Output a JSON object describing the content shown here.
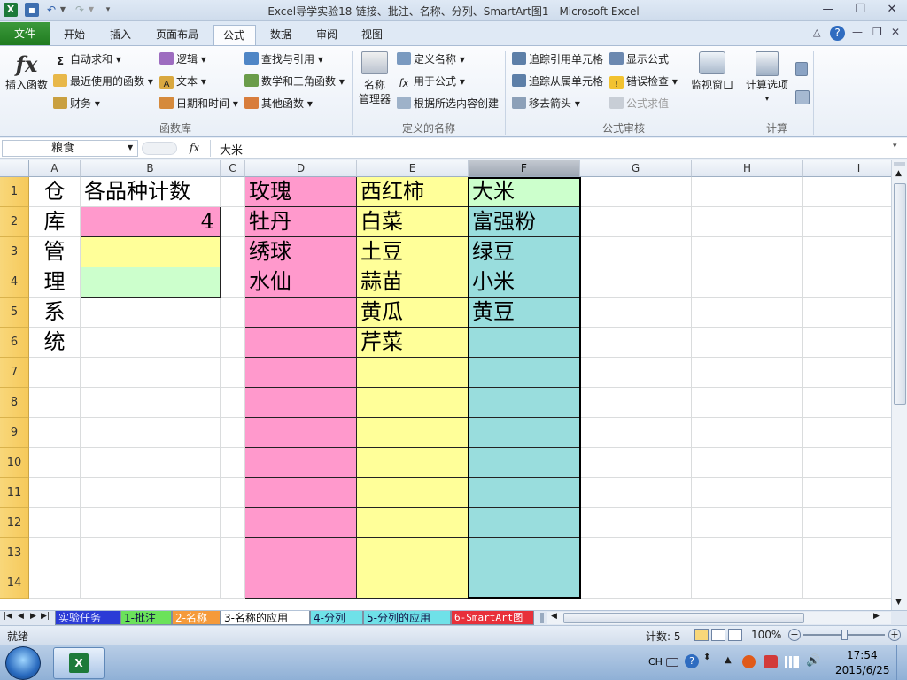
{
  "window": {
    "title": "Excel导学实验18-链接、批注、名称、分列、SmartArt图1 - Microsoft Excel",
    "controls": [
      "—",
      "❐",
      "✕"
    ]
  },
  "ribbon": {
    "file_tab": "文件",
    "tabs": [
      "开始",
      "插入",
      "页面布局",
      "公式",
      "数据",
      "审阅",
      "视图"
    ],
    "active_tab": "公式",
    "groups": {
      "function_library": {
        "label": "函数库",
        "insert_function": "插入函数",
        "items": [
          "自动求和",
          "最近使用的函数",
          "财务",
          "逻辑",
          "文本",
          "日期和时间",
          "查找与引用",
          "数学和三角函数",
          "其他函数"
        ]
      },
      "defined_names": {
        "label": "定义的名称",
        "name_manager": "名称\n管理器",
        "name_manager_l1": "名称",
        "name_manager_l2": "管理器",
        "items": [
          "定义名称",
          "用于公式",
          "根据所选内容创建"
        ]
      },
      "formula_auditing": {
        "label": "公式审核",
        "items": [
          "追踪引用单元格",
          "追踪从属单元格",
          "移去箭头",
          "显示公式",
          "错误检查",
          "公式求值"
        ],
        "watch_window": "监视窗口"
      },
      "calculation": {
        "label": "计算",
        "options": "计算选项"
      }
    }
  },
  "formula_bar": {
    "name_box": "粮食",
    "fx": "fx",
    "content": "大米"
  },
  "sheet": {
    "columns": [
      "A",
      "B",
      "C",
      "D",
      "E",
      "F",
      "G",
      "H",
      "I"
    ],
    "selected_column": "F",
    "rows": [
      "1",
      "2",
      "3",
      "4",
      "5",
      "6",
      "7",
      "8",
      "9",
      "10",
      "11",
      "12",
      "13",
      "14"
    ],
    "col_a": [
      "仓",
      "库",
      "管",
      "理",
      "系",
      "统"
    ],
    "b1": "各品种计数",
    "b2": "4",
    "col_d": [
      "玫瑰",
      "牡丹",
      "绣球",
      "水仙"
    ],
    "col_e": [
      "西红柿",
      "白菜",
      "土豆",
      "蒜苗",
      "黄瓜",
      "芹菜"
    ],
    "col_f": [
      "大米",
      "富强粉",
      "绿豆",
      "小米",
      "黄豆"
    ],
    "colors": {
      "pink": "#ff99cc",
      "yellow": "#ffff99",
      "green": "#ccffcc",
      "teal": "#99dddd",
      "header_yellow": "#f8d36b"
    }
  },
  "sheet_tabs": [
    "实验任务",
    "1-批注",
    "2-名称",
    "3-名称的应用",
    "4-分列",
    "5-分列的应用",
    "6-SmartArt图"
  ],
  "active_sheet": "3-名称的应用",
  "status": {
    "ready": "就绪",
    "count": "计数: 5",
    "zoom": "100%"
  },
  "taskbar": {
    "lang": "CH",
    "time": "17:54",
    "date": "2015/6/25"
  }
}
